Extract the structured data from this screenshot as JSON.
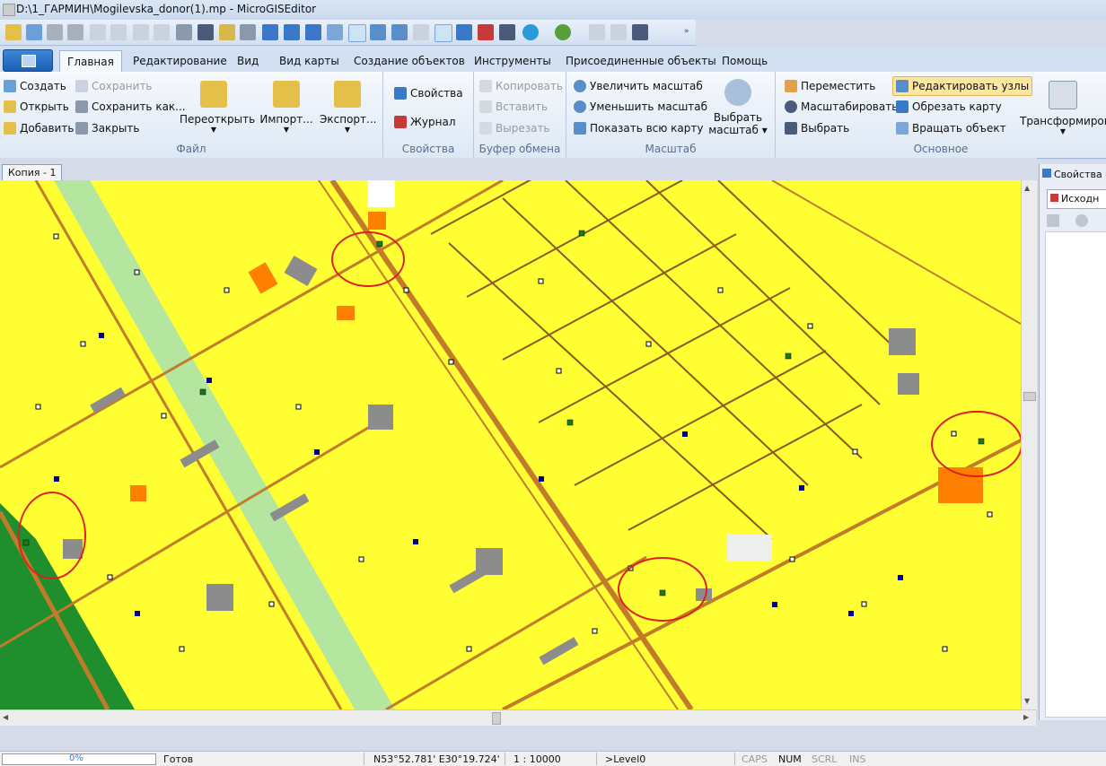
{
  "window": {
    "title": "D:\\1_ГАРМИН\\Mogilevska_donor(1).mp - MicroGISEditor"
  },
  "tabs": [
    {
      "label": "Главная",
      "active": true
    },
    {
      "label": "Редактирование"
    },
    {
      "label": "Вид"
    },
    {
      "label": "Вид карты"
    },
    {
      "label": "Создание объектов"
    },
    {
      "label": "Инструменты"
    },
    {
      "label": "Присоединенные объекты"
    },
    {
      "label": "Помощь"
    }
  ],
  "ribbon": {
    "file": {
      "title": "Файл",
      "create": "Создать",
      "open": "Открыть",
      "add": "Добавить",
      "save": "Сохранить",
      "save_as": "Сохранить как...",
      "close": "Закрыть",
      "reopen": "Переоткрыть",
      "import": "Импорт...",
      "export": "Экспорт..."
    },
    "properties": {
      "title": "Свойства",
      "props": "Свойства",
      "journal": "Журнал"
    },
    "clipboard": {
      "title": "Буфер обмена",
      "copy": "Копировать",
      "paste": "Вставить",
      "cut": "Вырезать"
    },
    "scale": {
      "title": "Масштаб",
      "zoom_in": "Увеличить масштаб",
      "zoom_out": "Уменьшить масштаб",
      "show_all": "Показать всю карту",
      "select_scale_1": "Выбрать",
      "select_scale_2": "масштаб"
    },
    "main": {
      "title": "Основное",
      "move": "Переместить",
      "zoom": "Масштабировать",
      "select": "Выбрать",
      "edit_nodes": "Редактировать узлы",
      "crop": "Обрезать карту",
      "rotate": "Вращать объект",
      "transform": "Трансформиров"
    }
  },
  "document": {
    "tab": "Копия - 1"
  },
  "right_panel": {
    "title": "Свойства о",
    "tab": "Исходн"
  },
  "status": {
    "progress": "0%",
    "progress_value": 0,
    "state": "Готов",
    "coords": "N53°52.781' E30°19.724'",
    "scale": "1 : 10000",
    "level": ">Level0",
    "caps": "CAPS",
    "num": "NUM",
    "scrl": "SCRL",
    "ins": "INS"
  },
  "colors": {
    "map_bg": "#ffff33",
    "road": "#c27b2a",
    "building": "#8c8c8c",
    "park": "#1f8f2e",
    "highlight": "#e02020"
  }
}
